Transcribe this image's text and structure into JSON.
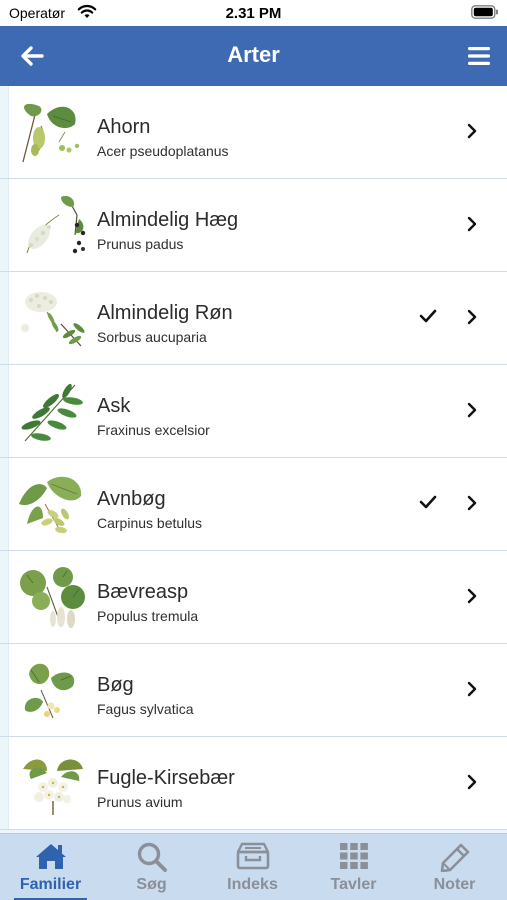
{
  "status": {
    "carrier": "Operatør",
    "time": "2.31 PM"
  },
  "nav": {
    "title": "Arter"
  },
  "species": [
    {
      "name": "Ahorn",
      "latin": "Acer pseudoplatanus",
      "checked": false
    },
    {
      "name": "Almindelig Hæg",
      "latin": "Prunus padus",
      "checked": false
    },
    {
      "name": "Almindelig Røn",
      "latin": "Sorbus aucuparia",
      "checked": true
    },
    {
      "name": "Ask",
      "latin": "Fraxinus excelsior",
      "checked": false
    },
    {
      "name": "Avnbøg",
      "latin": "Carpinus betulus",
      "checked": true
    },
    {
      "name": "Bævreasp",
      "latin": "Populus tremula",
      "checked": false
    },
    {
      "name": "Bøg",
      "latin": "Fagus sylvatica",
      "checked": false
    },
    {
      "name": "Fugle-Kirsebær",
      "latin": "Prunus avium",
      "checked": false
    }
  ],
  "tabs": [
    {
      "label": "Familier",
      "icon": "home-icon",
      "active": true
    },
    {
      "label": "Søg",
      "icon": "search-icon",
      "active": false
    },
    {
      "label": "Indeks",
      "icon": "archive-icon",
      "active": false
    },
    {
      "label": "Tavler",
      "icon": "grid-icon",
      "active": false
    },
    {
      "label": "Noter",
      "icon": "pencil-icon",
      "active": false
    }
  ],
  "colors": {
    "navbar": "#3d6ab3",
    "tabbar": "#c9dbee",
    "active_tab": "#2f63ad",
    "inactive_tab": "#8a8f98"
  }
}
